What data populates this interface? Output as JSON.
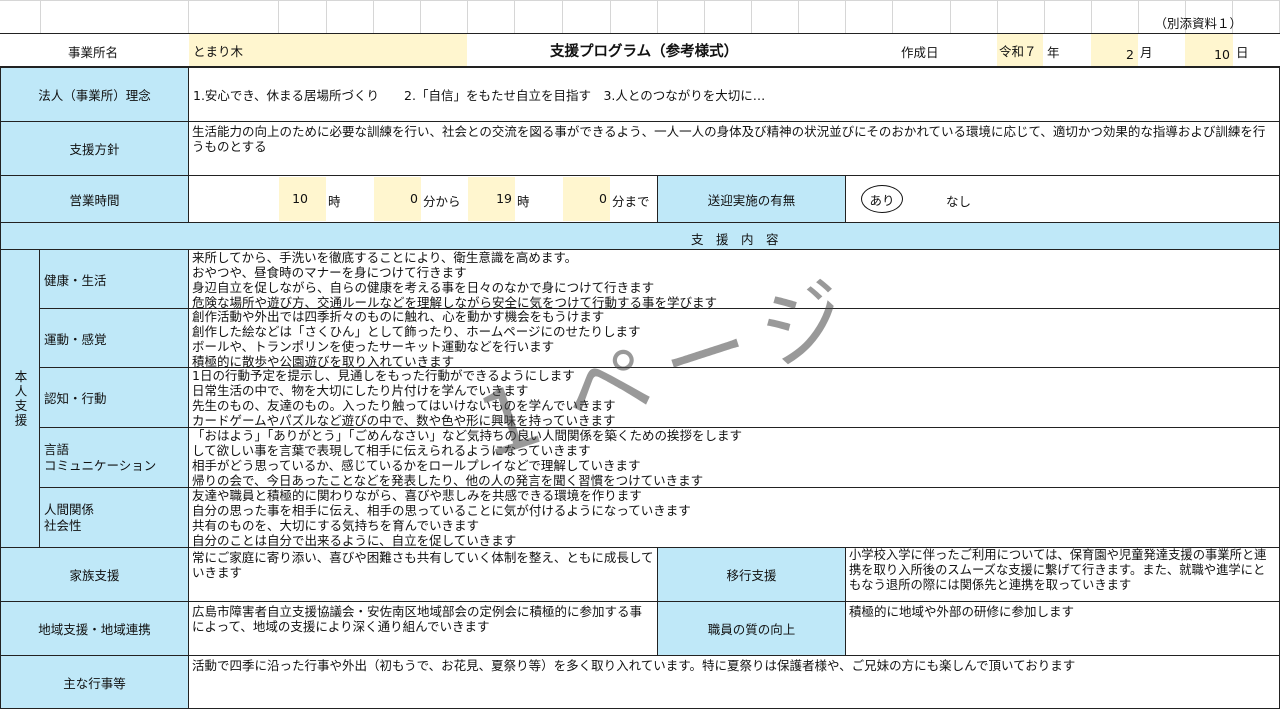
{
  "attachment_label": "（別添資料１）",
  "header": {
    "office_label": "事業所名",
    "office_name": "とまり木",
    "title": "支援プログラム（参考様式）",
    "created_label": "作成日",
    "era": "令和７",
    "year_unit": "年",
    "month": "2",
    "month_unit": "月",
    "day": "10",
    "day_unit": "日"
  },
  "philosophy": {
    "label": "法人（事業所）理念",
    "text": "1.安心でき、休まる居場所づくり　　2.「自信」をもたせ自立を目指す　3.人とのつながりを大切に…"
  },
  "policy": {
    "label": "支援方針",
    "text": "生活能力の向上のために必要な訓練を行い、社会との交流を図る事ができるよう、一人一人の身体及び精神の状況並びにそのおかれている環境に応じて、適切かつ効果的な指導および訓練を行うものとする"
  },
  "hours": {
    "label": "営業時間",
    "start_hour": "10",
    "hour_unit": "時",
    "start_min": "0",
    "from_unit": "分から",
    "end_hour": "19",
    "hour_unit2": "時",
    "end_min": "0",
    "until_unit": "分まで",
    "transport_label": "送迎実施の有無",
    "yes": "あり",
    "no": "なし"
  },
  "support_header": "支　援　内　容",
  "personal": {
    "label": "本人支援",
    "rows": [
      {
        "label": "健康・生活",
        "text": "来所してから、手洗いを徹底することにより、衛生意識を高めます。\nおやつや、昼食時のマナーを身につけて行きます\n身辺自立を促しながら、自らの健康を考える事を日々のなかで身につけて行きます\n危険な場所や遊び方、交通ルールなどを理解しながら安全に気をつけて行動する事を学びます"
      },
      {
        "label": "運動・感覚",
        "text": "創作活動や外出では四季折々のものに触れ、心を動かす機会をもうけます\n創作した絵などは「さくひん」として飾ったり、ホームページにのせたりします\nボールや、トランポリンを使ったサーキット運動などを行います\n積極的に散歩や公園遊びを取り入れていきます"
      },
      {
        "label": "認知・行動",
        "text": "1日の行動予定を提示し、見通しをもった行動ができるようにします\n日常生活の中で、物を大切にしたり片付けを学んでいきます\n先生のもの、友達のもの。入ったり触ってはいけないものを学んでいきます\nカードゲームやパズルなど遊びの中で、数や色や形に興味を持っていきます"
      },
      {
        "label": "言語\nコミュニケーション",
        "text": "「おはよう」「ありがとう」「ごめんなさい」など気持ちの良い人間関係を築くための挨拶をします\nして欲しい事を言葉で表現して相手に伝えられるようになっていきます\n相手がどう思っているか、感じているかをロールプレイなどで理解していきます\n帰りの会で、今日あったことなどを発表したり、他の人の発言を聞く習慣をつけていきます"
      },
      {
        "label": "人間関係\n社会性",
        "text": "友達や職員と積極的に関わりながら、喜びや悲しみを共感できる環境を作ります\n自分の思った事を相手に伝え、相手の思っていることに気が付けるようになっていきます\n共有のものを、大切にする気持ちを育んでいきます\n自分のことは自分で出来るように、自立を促していきます"
      }
    ]
  },
  "family": {
    "label": "家族支援",
    "text": "常にご家庭に寄り添い、喜びや困難さも共有していく体制を整え、ともに成長していきます"
  },
  "transition": {
    "label": "移行支援",
    "text": "小学校入学に伴ったご利用については、保育園や児童発達支援の事業所と連携を取り入所後のスムーズな支援に繋げて行きます。また、就職や進学にともなう退所の際には関係先と連携を取っていきます"
  },
  "community": {
    "label": "地域支援・地域連携",
    "text": "広島市障害者自立支援協議会・安佐南区地域部会の定例会に積極的に参加する事によって、地域の支援により深く通り組んでいきます"
  },
  "staff": {
    "label": "職員の質の向上",
    "text": "積極的に地域や外部の研修に参加します"
  },
  "events": {
    "label": "主な行事等",
    "text": "活動で四季に沿った行事や外出（初もうで、お花見、夏祭り等）を多く取り入れています。特に夏祭りは保護者様や、ご兄妹の方にも楽しんで頂いております"
  },
  "watermark": "１ページ"
}
